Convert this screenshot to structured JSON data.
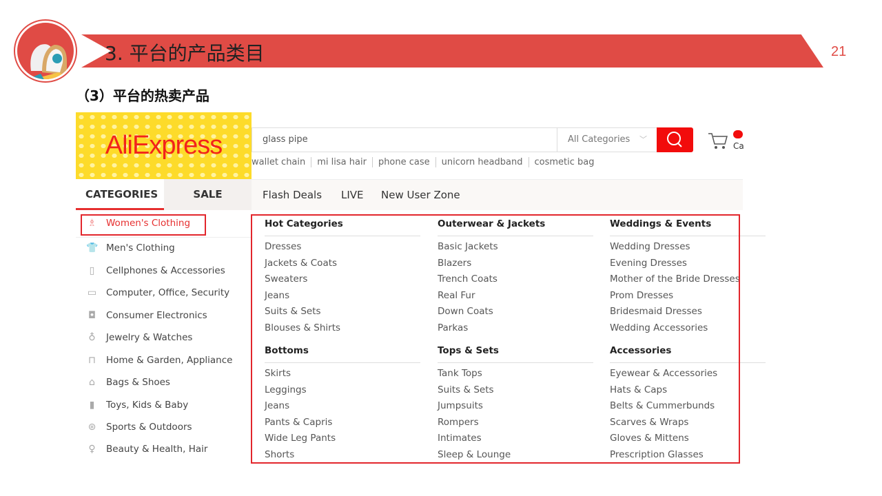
{
  "slide": {
    "title": "3. 平台的产品类目",
    "page_number": "21",
    "subtitle": "（3）平台的热卖产品"
  },
  "site": {
    "logo": "AliExpress",
    "search": {
      "value": "glass pipe",
      "category": "All Categories"
    },
    "hot_searches": [
      "wallet chain",
      "mi lisa hair",
      "phone case",
      "unicorn headband",
      "cosmetic bag"
    ],
    "cart_label": "Ca",
    "tabs": {
      "categories": "CATEGORIES",
      "sale": "SALE"
    },
    "nav_links": [
      "Flash Deals",
      "LIVE",
      "New User Zone"
    ],
    "sidebar": [
      {
        "label": "Women's Clothing",
        "icon": "dress-icon"
      },
      {
        "label": "Men's Clothing",
        "icon": "shirt-icon"
      },
      {
        "label": "Cellphones & Accessories",
        "icon": "phone-icon"
      },
      {
        "label": "Computer, Office, Security",
        "icon": "laptop-icon"
      },
      {
        "label": "Consumer Electronics",
        "icon": "camera-icon"
      },
      {
        "label": "Jewelry & Watches",
        "icon": "ring-icon"
      },
      {
        "label": "Home & Garden, Appliance",
        "icon": "sofa-icon"
      },
      {
        "label": "Bags & Shoes",
        "icon": "bag-icon"
      },
      {
        "label": "Toys, Kids & Baby",
        "icon": "bottle-icon"
      },
      {
        "label": "Sports & Outdoors",
        "icon": "ball-icon"
      },
      {
        "label": "Beauty & Health, Hair",
        "icon": "bulb-icon"
      }
    ],
    "columns": [
      [
        {
          "heading": "Hot Categories",
          "items": [
            "Dresses",
            "Jackets & Coats",
            "Sweaters",
            "Jeans",
            "Suits & Sets",
            "Blouses & Shirts"
          ]
        },
        {
          "heading": "Bottoms",
          "items": [
            "Skirts",
            "Leggings",
            "Jeans",
            "Pants & Capris",
            "Wide Leg Pants",
            "Shorts"
          ]
        }
      ],
      [
        {
          "heading": "Outerwear & Jackets",
          "items": [
            "Basic Jackets",
            "Blazers",
            "Trench Coats",
            "Real Fur",
            "Down Coats",
            "Parkas"
          ]
        },
        {
          "heading": "Tops & Sets",
          "items": [
            "Tank Tops",
            "Suits & Sets",
            "Jumpsuits",
            "Rompers",
            "Intimates",
            "Sleep & Lounge"
          ]
        }
      ],
      [
        {
          "heading": "Weddings & Events",
          "items": [
            "Wedding Dresses",
            "Evening Dresses",
            "Mother of the Bride Dresses",
            "Prom Dresses",
            "Bridesmaid Dresses",
            "Wedding Accessories"
          ]
        },
        {
          "heading": "Accessories",
          "items": [
            "Eyewear & Accessories",
            "Hats & Caps",
            "Belts & Cummerbunds",
            "Scarves & Wraps",
            "Gloves & Mittens",
            "Prescription Glasses"
          ]
        }
      ]
    ]
  }
}
